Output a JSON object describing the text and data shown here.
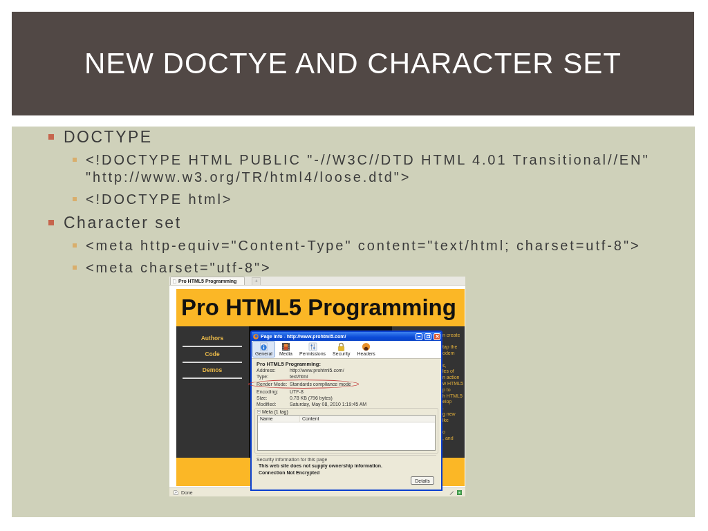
{
  "title": "NEW DOCTYE AND CHARACTER SET",
  "bullets": [
    {
      "text": "DOCTYPE",
      "children": [
        {
          "text": "<!DOCTYPE HTML PUBLIC \"-//W3C//DTD HTML 4.01 Transitional//EN\" \"http://www.w3.org/TR/html4/loose.dtd\">"
        },
        {
          "text": "<!DOCTYPE html>"
        }
      ]
    },
    {
      "text": "Character set",
      "children": [
        {
          "text": "<meta http-equiv=\"Content-Type\" content=\"text/html; charset=utf-8\">"
        },
        {
          "text": "<meta charset=\"utf-8\">"
        }
      ]
    }
  ],
  "screenshot": {
    "browser_tabs": [
      {
        "label": "Pro HTML5 Programming",
        "selected": true
      }
    ],
    "new_tab_button": "+",
    "site": {
      "heading": "Pro HTML5 Programming",
      "nav": [
        "Authors",
        "Code",
        "Demos"
      ],
      "column_text": [
        [
          "n create"
        ],
        [
          "tap the",
          "odem"
        ],
        [
          "s,",
          "les of",
          "n action",
          "w HTML5",
          "p to",
          "h HTML5",
          "elop",
          ".",
          "g new",
          "ike"
        ],
        [
          "o",
          ", and"
        ]
      ]
    },
    "dialog": {
      "title": "Page Info - http://www.prohtml5.com/",
      "tabs": [
        {
          "label": "General",
          "selected": true
        },
        {
          "label": "Media",
          "selected": false
        },
        {
          "label": "Permissions",
          "selected": false
        },
        {
          "label": "Security",
          "selected": false
        },
        {
          "label": "Headers",
          "selected": false
        }
      ],
      "page_name": "Pro HTML5 Programming:",
      "fields": [
        {
          "label": "Address:",
          "value": "http://www.prohtml5.com/",
          "highlighted": false
        },
        {
          "label": "Type:",
          "value": "text/html",
          "highlighted": false
        },
        {
          "label": "Render Mode:",
          "value": "Standards compliance mode",
          "highlighted": true
        },
        {
          "label": "Encoding:",
          "value": "UTF-8",
          "highlighted": false
        },
        {
          "label": "Size:",
          "value": "0.78 KB (796 bytes)",
          "highlighted": false
        },
        {
          "label": "Modified:",
          "value": "Saturday, May 08, 2010 1:19:45 AM",
          "highlighted": false
        }
      ],
      "meta": {
        "label": "Meta (1 tag)",
        "expanded": true,
        "columns": [
          "Name",
          "Content"
        ]
      },
      "security": {
        "heading": "Security information for this page",
        "lines": [
          "This web site does not supply ownership information.",
          "Connection Not Encrypted"
        ]
      },
      "buttons": [
        "Details"
      ]
    },
    "status_bar": {
      "text": "Done"
    }
  }
}
